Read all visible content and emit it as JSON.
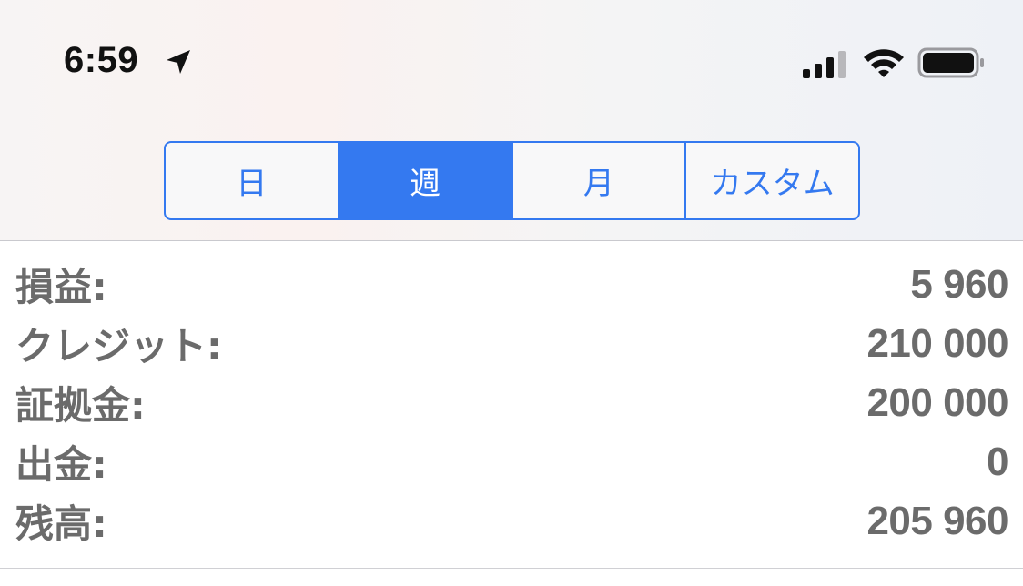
{
  "status_bar": {
    "time": "6:59",
    "icons": [
      "location-arrow-icon",
      "cellular-signal-icon",
      "wifi-icon",
      "battery-icon"
    ]
  },
  "segments": {
    "items": [
      {
        "label": "日"
      },
      {
        "label": "週"
      },
      {
        "label": "月"
      },
      {
        "label": "カスタム"
      }
    ],
    "selected": "週"
  },
  "summary": {
    "rows": [
      {
        "label": "損益:",
        "value": "5 960"
      },
      {
        "label": "クレジット:",
        "value": "210 000"
      },
      {
        "label": "証拠金:",
        "value": "200 000"
      },
      {
        "label": "出金:",
        "value": "0"
      },
      {
        "label": "残高:",
        "value": "205 960"
      }
    ]
  },
  "colors": {
    "accent": "#3479f0",
    "row_text": "#6b6b6b"
  }
}
